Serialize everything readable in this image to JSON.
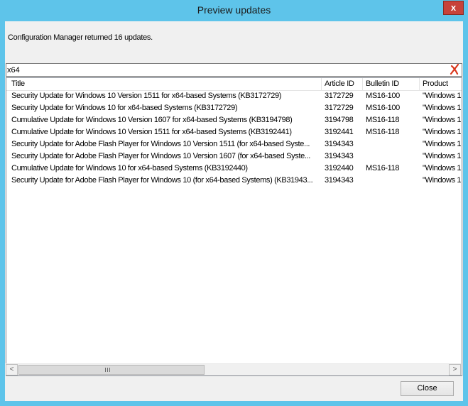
{
  "window": {
    "title": "Preview updates",
    "close_glyph": "x"
  },
  "status_text": "Configuration Manager returned 16 updates.",
  "filter": {
    "value": "x64"
  },
  "columns": {
    "title": "Title",
    "article_id": "Article ID",
    "bulletin_id": "Bulletin ID",
    "product": "Product"
  },
  "rows": [
    {
      "title": "Security Update for Windows 10 Version 1511 for x64-based Systems (KB3172729)",
      "article_id": "3172729",
      "bulletin_id": "MS16-100",
      "product": "\"Windows 1"
    },
    {
      "title": "Security Update for Windows 10 for x64-based Systems (KB3172729)",
      "article_id": "3172729",
      "bulletin_id": "MS16-100",
      "product": "\"Windows 1"
    },
    {
      "title": "Cumulative Update for Windows 10 Version 1607 for x64-based Systems (KB3194798)",
      "article_id": "3194798",
      "bulletin_id": "MS16-118",
      "product": "\"Windows 1"
    },
    {
      "title": "Cumulative Update for Windows 10 Version 1511 for x64-based Systems (KB3192441)",
      "article_id": "3192441",
      "bulletin_id": "MS16-118",
      "product": "\"Windows 1"
    },
    {
      "title": "Security Update for Adobe Flash Player for Windows 10 Version 1511 (for x64-based Syste...",
      "article_id": "3194343",
      "bulletin_id": "",
      "product": "\"Windows 1"
    },
    {
      "title": "Security Update for Adobe Flash Player for Windows 10 Version 1607 (for x64-based Syste...",
      "article_id": "3194343",
      "bulletin_id": "",
      "product": "\"Windows 1"
    },
    {
      "title": "Cumulative Update for Windows 10 for x64-based Systems (KB3192440)",
      "article_id": "3192440",
      "bulletin_id": "MS16-118",
      "product": "\"Windows 1"
    },
    {
      "title": "Security Update for Adobe Flash Player for Windows 10 (for x64-based Systems) (KB31943...",
      "article_id": "3194343",
      "bulletin_id": "",
      "product": "\"Windows 1"
    }
  ],
  "scrollbar": {
    "left_glyph": "<",
    "right_glyph": ">"
  },
  "buttons": {
    "close_label": "Close"
  },
  "colors": {
    "title_bar": "#5ec4ea",
    "close_button": "#c7423a",
    "clear_filter_icon": "#d9361c"
  }
}
